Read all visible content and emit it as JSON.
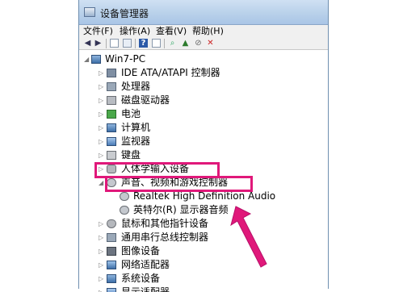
{
  "window": {
    "title": "设备管理器"
  },
  "menu": [
    "文件(F)",
    "操作(A)",
    "查看(V)",
    "帮助(H)"
  ],
  "toolbar": [
    "back-icon",
    "forward-icon",
    "properties-icon",
    "refresh-icon",
    "help-icon",
    "console-icon",
    "scan-icon",
    "update-driver-icon",
    "disable-icon",
    "uninstall-icon"
  ],
  "tree": {
    "root": "Win7-PC",
    "items": [
      {
        "label": "IDE ATA/ATAPI 控制器",
        "icon": "ide-controller-icon"
      },
      {
        "label": "处理器",
        "icon": "processor-icon"
      },
      {
        "label": "磁盘驱动器",
        "icon": "disk-drive-icon"
      },
      {
        "label": "电池",
        "icon": "battery-icon"
      },
      {
        "label": "计算机",
        "icon": "computer-icon"
      },
      {
        "label": "监视器",
        "icon": "monitor-icon"
      },
      {
        "label": "键盘",
        "icon": "keyboard-icon"
      },
      {
        "label": "人体学输入设备",
        "icon": "hid-icon"
      },
      {
        "label": "声音、视频和游戏控制器",
        "icon": "sound-icon",
        "expanded": true,
        "children": [
          {
            "label": "Realtek High Definition Audio",
            "icon": "speaker-icon"
          },
          {
            "label": "英特尔(R) 显示器音频",
            "icon": "speaker-icon"
          }
        ]
      },
      {
        "label": "鼠标和其他指针设备",
        "icon": "mouse-icon"
      },
      {
        "label": "通用串行总线控制器",
        "icon": "usb-icon"
      },
      {
        "label": "图像设备",
        "icon": "camera-icon"
      },
      {
        "label": "网络适配器",
        "icon": "network-icon"
      },
      {
        "label": "系统设备",
        "icon": "system-icon"
      },
      {
        "label": "显示适配器",
        "icon": "display-adapter-icon"
      }
    ]
  },
  "colors": {
    "highlight": "#e0187a",
    "title_bar": "#b9d1ea"
  }
}
